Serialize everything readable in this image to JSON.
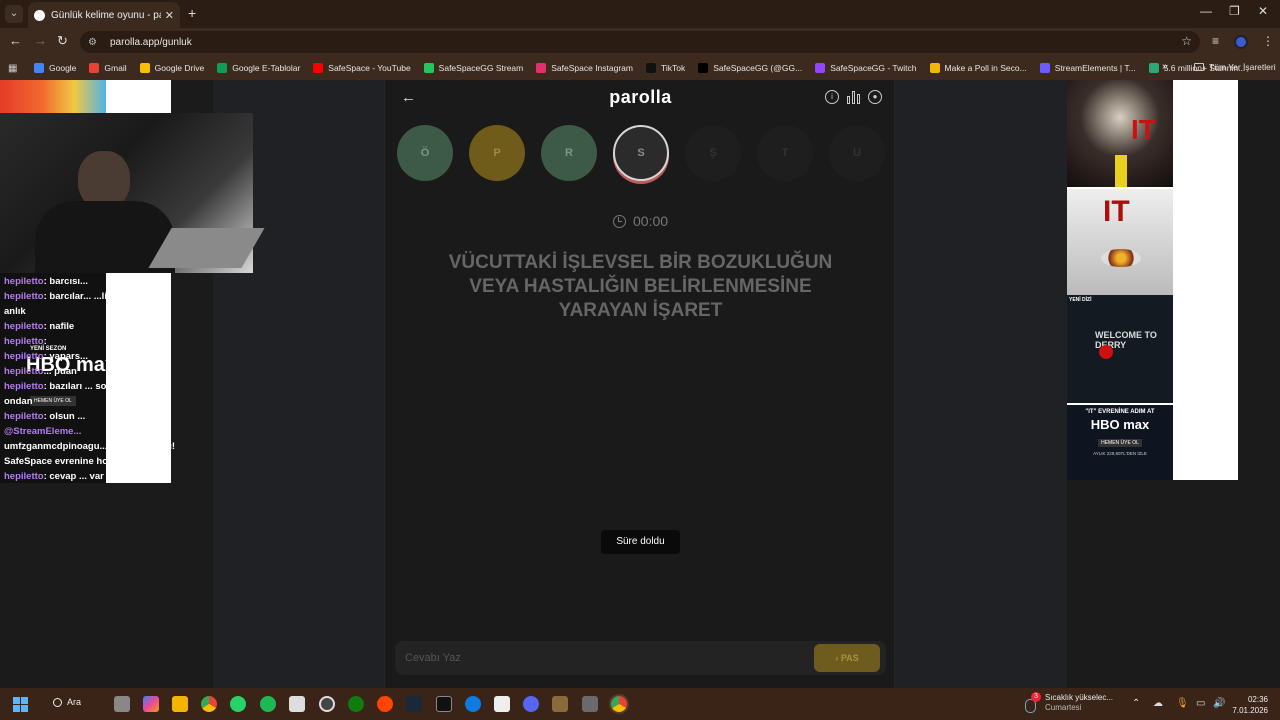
{
  "browser": {
    "tab_title": "Günlük kelime oyunu - parolla",
    "url": "parolla.app/gunluk",
    "bookmarks": [
      {
        "label": "Google",
        "color": "#4285f4"
      },
      {
        "label": "Gmail",
        "color": "#ea4335"
      },
      {
        "label": "Google Drive",
        "color": "#fbbc04"
      },
      {
        "label": "Google E-Tablolar",
        "color": "#0f9d58"
      },
      {
        "label": "SafeSpace - YouTube",
        "color": "#ff0000"
      },
      {
        "label": "SafeSpaceGG Stream",
        "color": "#22c55e"
      },
      {
        "label": "SafeSpace Instagram",
        "color": "#e1306c"
      },
      {
        "label": "TikTok",
        "color": "#111111"
      },
      {
        "label": "SafeSpaceGG (@GG...",
        "color": "#000000"
      },
      {
        "label": "SafeSpaceGG - Twitch",
        "color": "#9146ff"
      },
      {
        "label": "Make a Poll in Seco...",
        "color": "#f2b705"
      },
      {
        "label": "StreamElements | T...",
        "color": "#6a5cff"
      },
      {
        "label": "5.6 million+ Stunnin...",
        "color": "#2aa876"
      }
    ],
    "all_bookmarks": "Tüm Yer İşaretleri"
  },
  "game": {
    "logo": "parolla",
    "letters": [
      {
        "letter": "Ö",
        "state": "correct",
        "color": "#3d5a47",
        "text_color": "#7a9985"
      },
      {
        "letter": "P",
        "state": "passed",
        "color": "#6f5c1a",
        "text_color": "#a3893a"
      },
      {
        "letter": "R",
        "state": "correct",
        "color": "#3d5a47",
        "text_color": "#7a9985"
      },
      {
        "letter": "S",
        "state": "current",
        "color": "#2b2b2b",
        "text_color": "#8a8a8a"
      },
      {
        "letter": "Ş",
        "state": "pending",
        "color": "#1e1e1e",
        "text_color": "#333333"
      },
      {
        "letter": "T",
        "state": "pending",
        "color": "#1e1e1e",
        "text_color": "#333333"
      },
      {
        "letter": "U",
        "state": "pending",
        "color": "#1e1e1e",
        "text_color": "#333333"
      }
    ],
    "timer": "00:00",
    "question": "VÜCUTTAKİ İŞLEVSEL BİR BOZUKLUĞUN VEYA HASTALIĞIN BELİRLENMESİNE YARAYAN İŞARET",
    "toast": "Süre doldu",
    "answer_placeholder": "Cevabı Yaz",
    "pass_label": "PAS"
  },
  "chat": [
    {
      "user": "hepiletto",
      "msg": ": barcısı..."
    },
    {
      "user": "hepiletto",
      "msg": ": barcılar... ...linden atıldın"
    },
    {
      "user": "",
      "msg": "anlık"
    },
    {
      "user": "hepiletto",
      "msg": ": nafile"
    },
    {
      "user": "hepiletto",
      "msg": ":"
    },
    {
      "user": "hepiletto",
      "msg": ": yapars..."
    },
    {
      "user": "hepiletto",
      "msg": "... puan"
    },
    {
      "user": "hepiletto",
      "msg": ": bazıları ... sorular ya"
    },
    {
      "user": "",
      "msg": "ondan"
    },
    {
      "user": "hepiletto",
      "msg": ": olsun ..."
    },
    {
      "user": "@StreamEleme...",
      "msg": ""
    },
    {
      "user": "",
      "msg": "umfzganmcdpinoagu... ...ımıza katıldı!"
    },
    {
      "user": "",
      "msg": "SafeSpace evrenine ho..."
    },
    {
      "user": "hepiletto",
      "msg": ": cevap ... var"
    }
  ],
  "ads": {
    "left_new": "YENİ SEZON",
    "left_brand": "HBO max",
    "left_cta": "HEMEN ÜYE OL",
    "it1": "IT",
    "it2": "IT",
    "series_tag": "YENİ DİZİ",
    "series_title": "WELCOME TO DERRY",
    "promo_line": "\"IT\" EVRENİNE ADIM AT",
    "promo_brand": "HBO max",
    "promo_cta": "HEMEN ÜYE OL",
    "promo_price": "AYLIK 229,90TL'DEN İZLE"
  },
  "taskbar": {
    "search": "Ara",
    "weather_count": "3",
    "weather_title": "Sıcaklık yükselec...",
    "weather_day": "Cumartesi",
    "time": "02:36",
    "date": "7.01.2026"
  }
}
